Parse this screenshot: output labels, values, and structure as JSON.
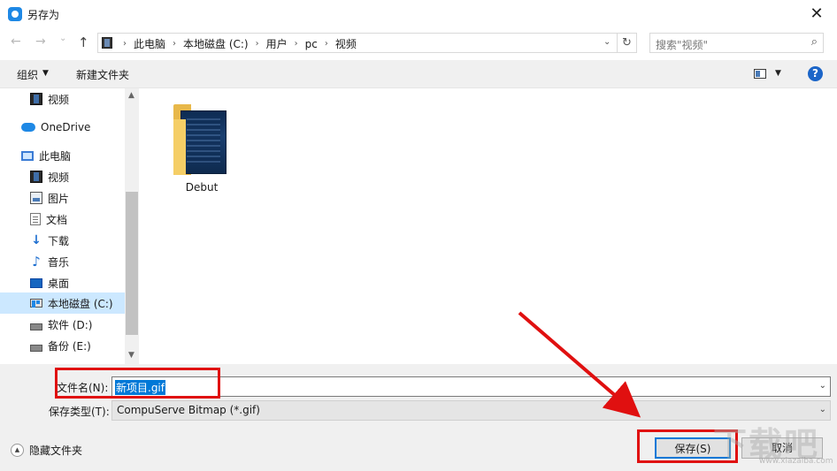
{
  "window": {
    "title": "另存为",
    "close": "✕"
  },
  "navigation": {
    "back": "←",
    "forward": "→",
    "recent": "⌄",
    "up": "↑",
    "breadcrumbs": [
      "此电脑",
      "本地磁盘 (C:)",
      "用户",
      "pc",
      "视频"
    ],
    "separator": "›",
    "address_dropdown": "⌄",
    "refresh": "↻",
    "search_placeholder": "搜索\"视频\"",
    "search_icon": "⌕"
  },
  "toolbar": {
    "organize_label": "组织",
    "organize_caret": "▼",
    "new_folder_label": "新建文件夹",
    "view_caret": "▼",
    "help": "?"
  },
  "sidebar": {
    "items": [
      {
        "label": "视频",
        "icon": "video-library-icon"
      },
      {
        "label": "OneDrive",
        "icon": "onedrive-cloud-icon"
      },
      {
        "label": "此电脑",
        "icon": "this-pc-icon"
      },
      {
        "label": "视频",
        "icon": "video-folder-icon"
      },
      {
        "label": "图片",
        "icon": "pictures-folder-icon"
      },
      {
        "label": "文档",
        "icon": "documents-folder-icon"
      },
      {
        "label": "下载",
        "icon": "downloads-folder-icon"
      },
      {
        "label": "音乐",
        "icon": "music-folder-icon"
      },
      {
        "label": "桌面",
        "icon": "desktop-folder-icon"
      },
      {
        "label": "本地磁盘 (C:)",
        "icon": "drive-c-icon",
        "selected": true
      },
      {
        "label": "软件 (D:)",
        "icon": "drive-d-icon"
      },
      {
        "label": "备份 (E:)",
        "icon": "drive-e-icon"
      }
    ],
    "scroll_up": "▲",
    "scroll_down": "▼"
  },
  "content": {
    "items": [
      {
        "label": "Debut",
        "type": "folder"
      }
    ]
  },
  "form": {
    "filename_label": "文件名(N):",
    "filename_value": "新项目.gif",
    "filetype_label": "保存类型(T):",
    "filetype_value": "CompuServe Bitmap (*.gif)",
    "dropdown_caret": "⌄"
  },
  "footer": {
    "hide_folders_label": "隐藏文件夹",
    "hide_folders_icon": "▲",
    "save_label": "保存(S)",
    "cancel_label": "取消"
  },
  "watermark": {
    "text": "下载吧",
    "sub": "www.xiazaiba.com"
  },
  "colors": {
    "accent": "#0078d7",
    "selection": "#cce8ff",
    "annotation": "#e01010",
    "help": "#1b65c8"
  }
}
